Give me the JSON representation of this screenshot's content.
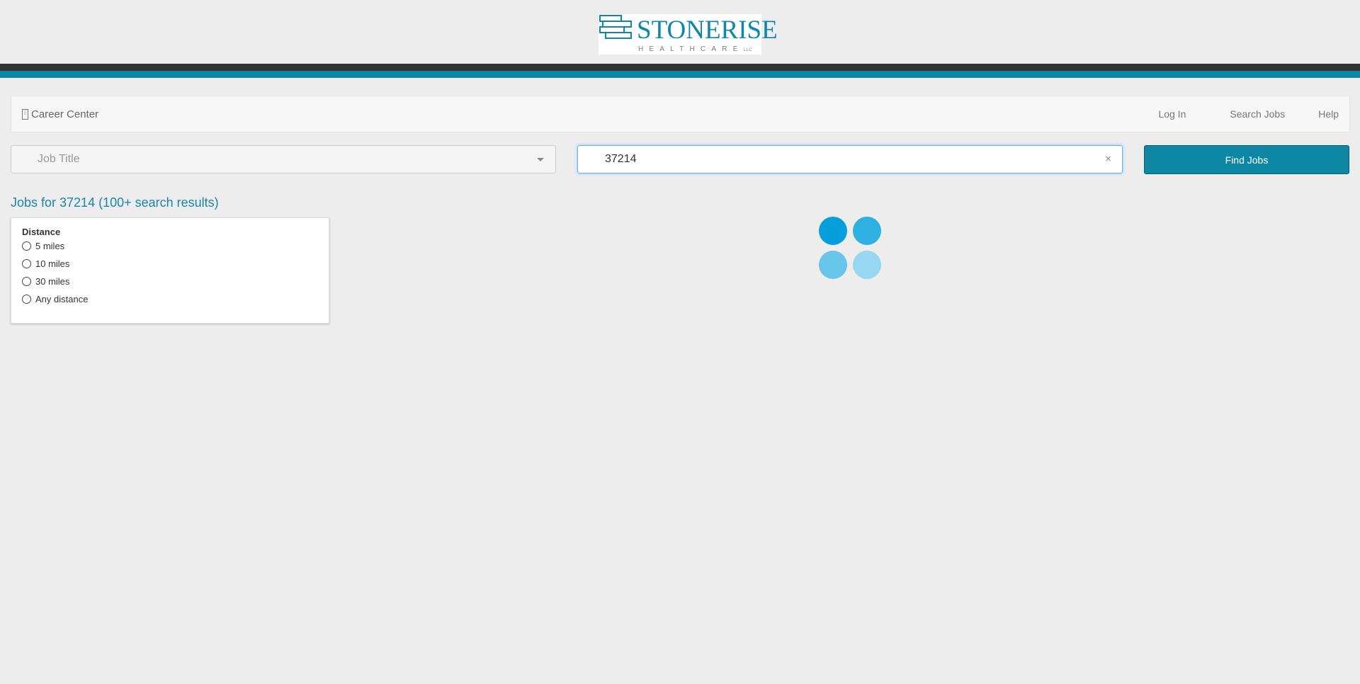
{
  "brand": {
    "logo_name": "STONERISE",
    "logo_sub": "HEALTHCARE",
    "logo_llc": "LLC",
    "primary_color": "#0e87a4",
    "dark_stripe_color": "#333333"
  },
  "navbar": {
    "brand_label": "Career Center",
    "brand_icon": "building-icon",
    "links": [
      {
        "label": "Log In"
      },
      {
        "label": "Search Jobs"
      },
      {
        "label": "Help"
      }
    ]
  },
  "search": {
    "job_title_placeholder": "Job Title",
    "location_value": "37214",
    "clear_label": "×",
    "find_button_label": "Find Jobs"
  },
  "results": {
    "heading": "Jobs for 37214 (100+ search results)"
  },
  "filters": {
    "distance_title": "Distance",
    "options": [
      "5 miles",
      "10 miles",
      "30 miles",
      "Any distance"
    ]
  },
  "loader": {
    "colors": [
      "#079fdb",
      "#2fb0e2",
      "#67c5ea",
      "#97d7f1"
    ]
  }
}
